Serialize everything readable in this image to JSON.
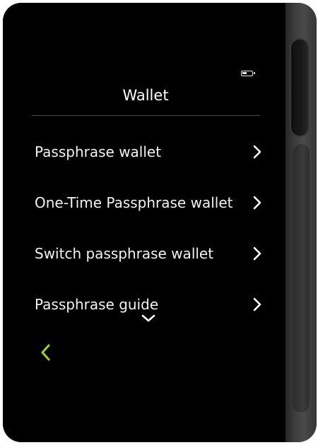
{
  "status_bar": {
    "battery_icon": "battery-icon",
    "battery_level": 0.5
  },
  "header": {
    "title": "Wallet"
  },
  "menu": {
    "items": [
      {
        "label": "Passphrase wallet",
        "icon": "chevron-right-icon"
      },
      {
        "label": "One-Time Passphrase wallet",
        "icon": "chevron-right-icon"
      },
      {
        "label": "Switch passphrase wallet",
        "icon": "chevron-right-icon"
      },
      {
        "label": "Passphrase guide",
        "icon": "chevron-right-icon"
      }
    ]
  },
  "footer": {
    "scroll_more_icon": "chevron-down-icon",
    "back_icon": "chevron-left-icon"
  },
  "colors": {
    "screen_background": "#000000",
    "text": "#ffffff",
    "divider": "#4a4a4a",
    "accent_back": "#a6d11c"
  }
}
